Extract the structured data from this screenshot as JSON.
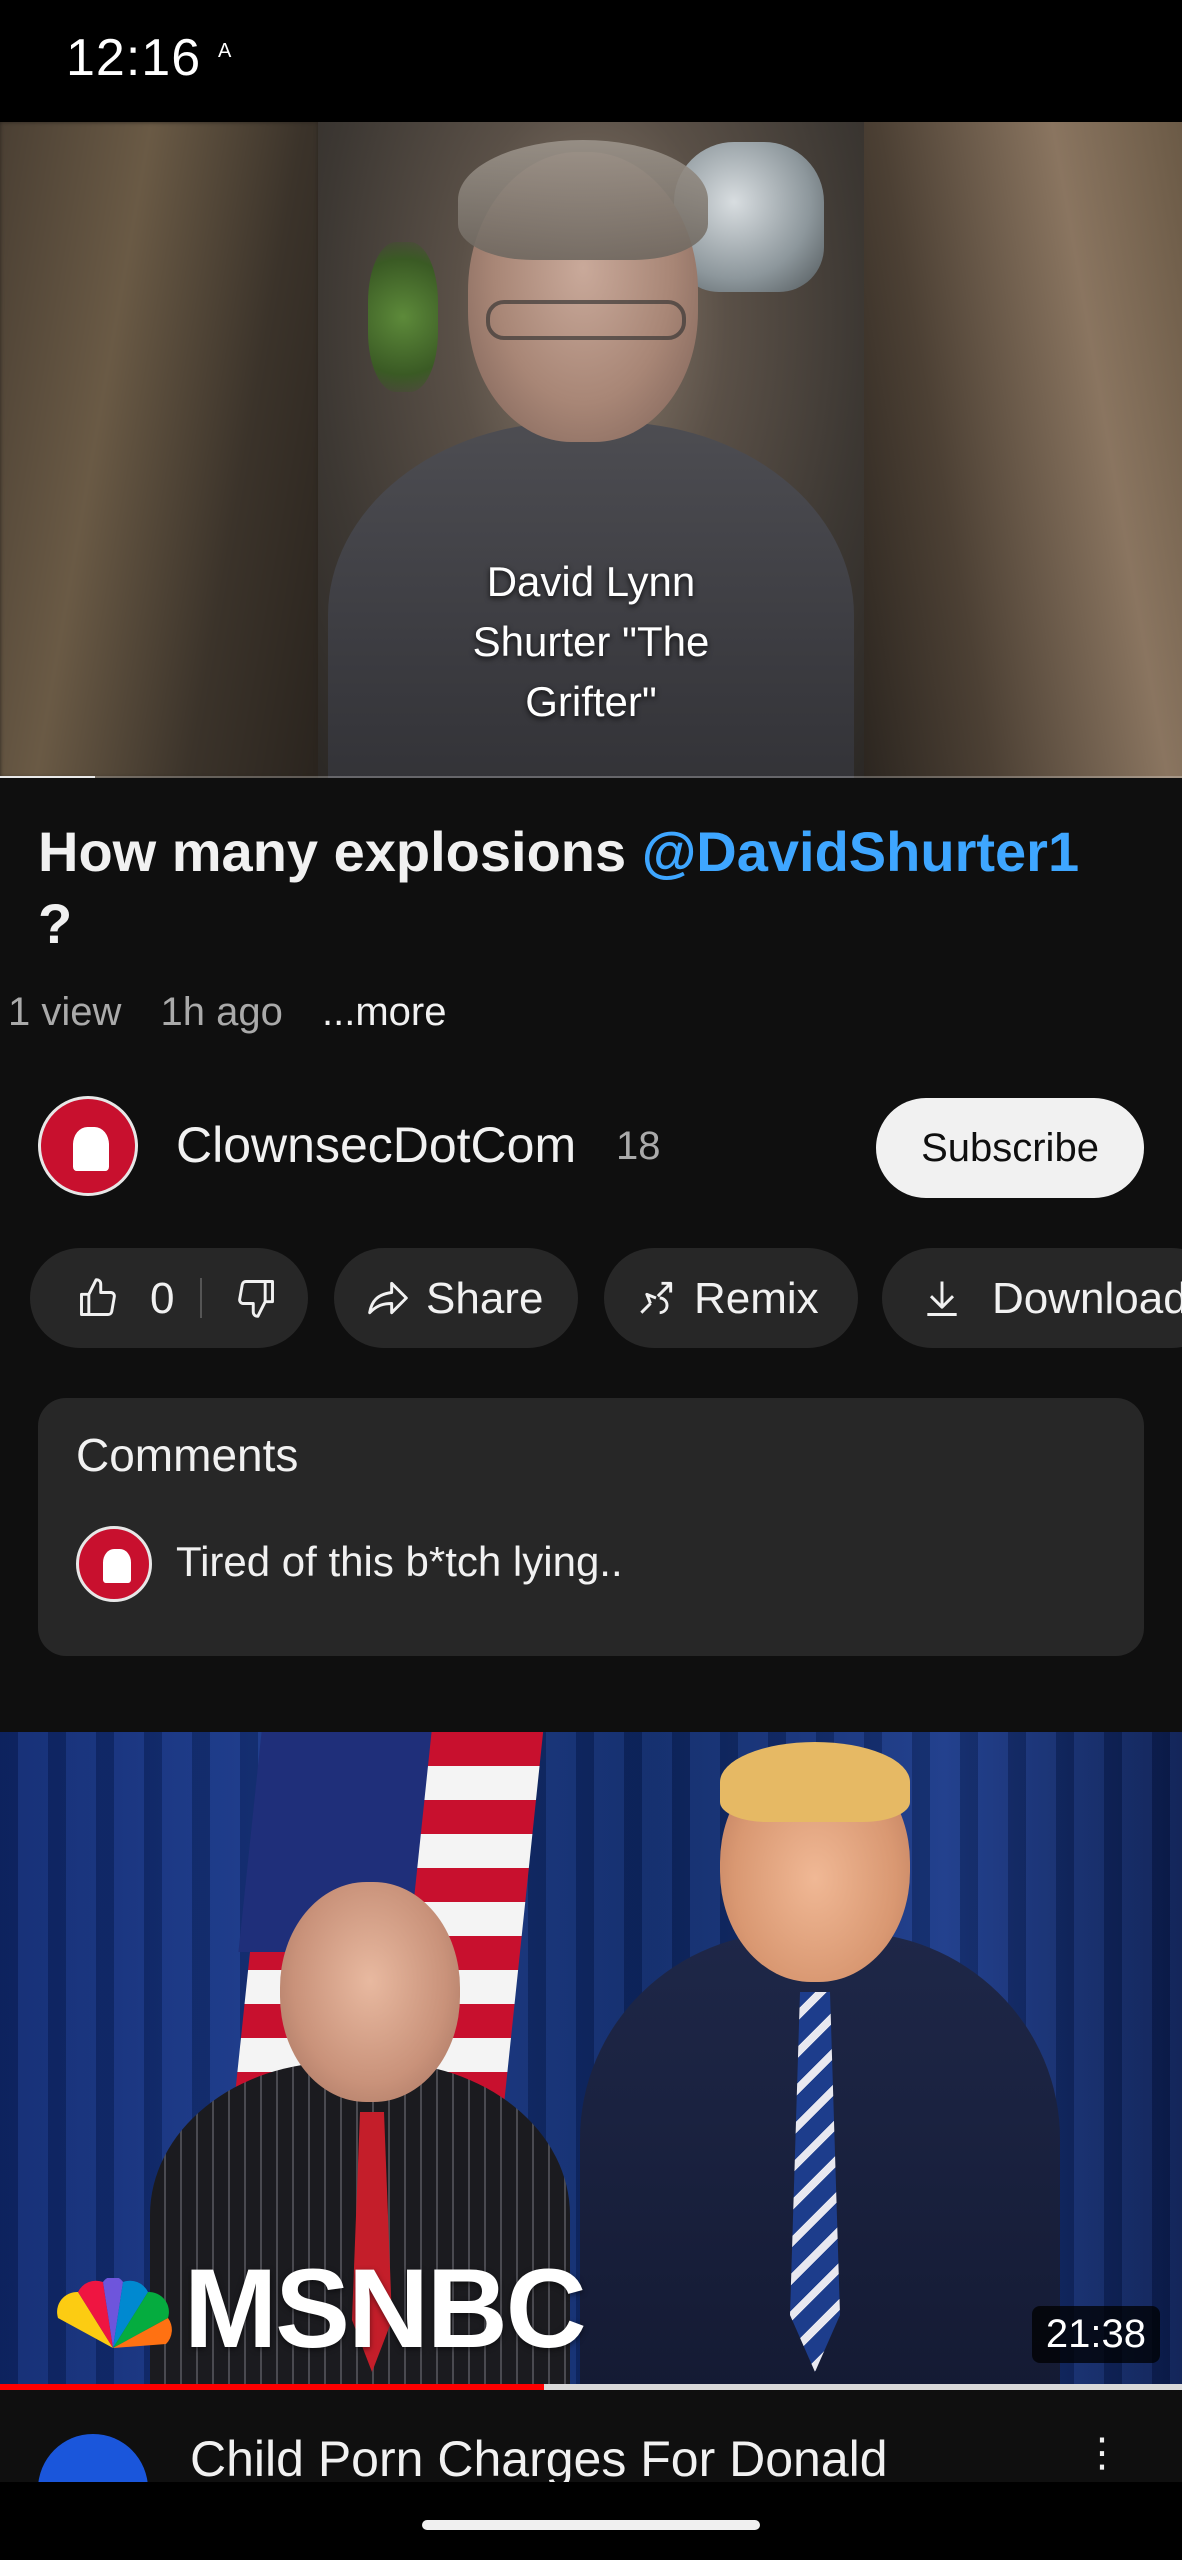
{
  "status_bar": {
    "time": "12:16",
    "indicator": "A"
  },
  "player": {
    "caption_lines": [
      "David Lynn",
      "Shurter \"The",
      "Grifter\""
    ],
    "progress": 0.08
  },
  "video": {
    "title_prefix": "How many explosions ",
    "title_mention": "@DavidShurter1",
    "title_suffix": "?",
    "views": "1 view",
    "age": "1h ago",
    "more": "...more"
  },
  "channel": {
    "name": "ClownsecDotCom",
    "subscribers": "18",
    "subscribe_label": "Subscribe"
  },
  "actions": {
    "like_count": "0",
    "share_label": "Share",
    "remix_label": "Remix",
    "download_label": "Download"
  },
  "comments": {
    "title": "Comments",
    "top_comment": "Tired of this b*tch lying.."
  },
  "next_video": {
    "logo_text": "MSNBC",
    "duration": "21:38",
    "watched_progress": 0.46,
    "title": "Child Porn Charges For Donald"
  },
  "colors": {
    "background": "#0f0f0f",
    "mention": "#3ea6ff",
    "pill": "#272727",
    "subscribe_bg": "#f1f1f1",
    "progress_red": "#ff0000"
  }
}
